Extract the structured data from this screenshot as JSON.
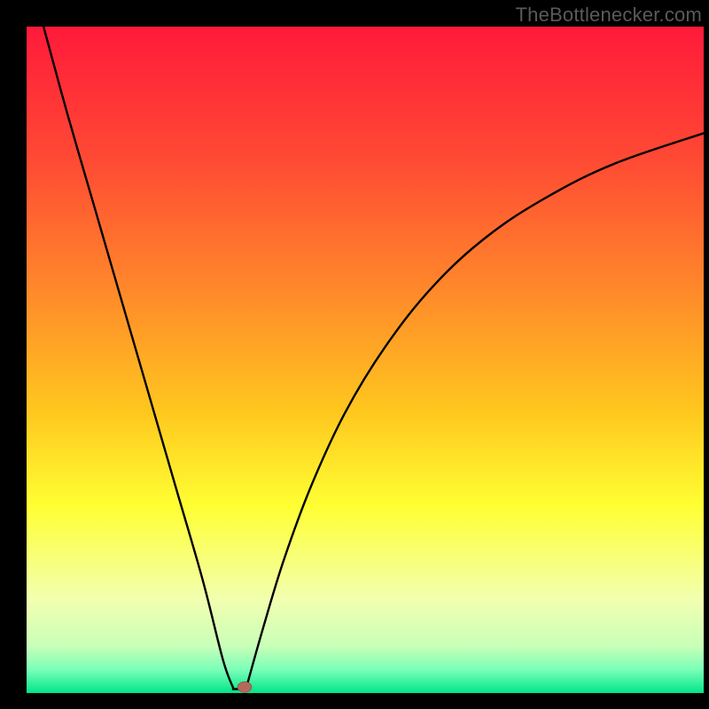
{
  "watermark": "TheBottlenecker.com",
  "chart_data": {
    "type": "line",
    "title": "",
    "xlabel": "",
    "ylabel": "",
    "xlim": [
      0,
      100
    ],
    "ylim": [
      0,
      100
    ],
    "grid": false,
    "legend": false,
    "annotations": [],
    "minimum_point": {
      "x": 31,
      "y": 0
    },
    "background_gradient_stops": [
      {
        "offset": 0.0,
        "color": "#ff1a3a"
      },
      {
        "offset": 0.2,
        "color": "#ff4a34"
      },
      {
        "offset": 0.4,
        "color": "#ff8a2a"
      },
      {
        "offset": 0.58,
        "color": "#ffc81e"
      },
      {
        "offset": 0.72,
        "color": "#ffff33"
      },
      {
        "offset": 0.86,
        "color": "#f2ffb0"
      },
      {
        "offset": 0.93,
        "color": "#c8ffb8"
      },
      {
        "offset": 0.965,
        "color": "#7affb8"
      },
      {
        "offset": 1.0,
        "color": "#00e68a"
      }
    ],
    "left_curve": [
      {
        "x": 2.5,
        "y": 100
      },
      {
        "x": 6,
        "y": 87
      },
      {
        "x": 10,
        "y": 73
      },
      {
        "x": 14,
        "y": 59
      },
      {
        "x": 18,
        "y": 45
      },
      {
        "x": 22,
        "y": 31
      },
      {
        "x": 26,
        "y": 17
      },
      {
        "x": 29,
        "y": 5
      },
      {
        "x": 30.5,
        "y": 0.8
      }
    ],
    "right_curve": [
      {
        "x": 32.5,
        "y": 1
      },
      {
        "x": 35,
        "y": 10
      },
      {
        "x": 38,
        "y": 20
      },
      {
        "x": 42,
        "y": 31
      },
      {
        "x": 47,
        "y": 42
      },
      {
        "x": 53,
        "y": 52
      },
      {
        "x": 60,
        "y": 61
      },
      {
        "x": 68,
        "y": 68.5
      },
      {
        "x": 77,
        "y": 74.5
      },
      {
        "x": 87,
        "y": 79.5
      },
      {
        "x": 100,
        "y": 84
      }
    ]
  }
}
